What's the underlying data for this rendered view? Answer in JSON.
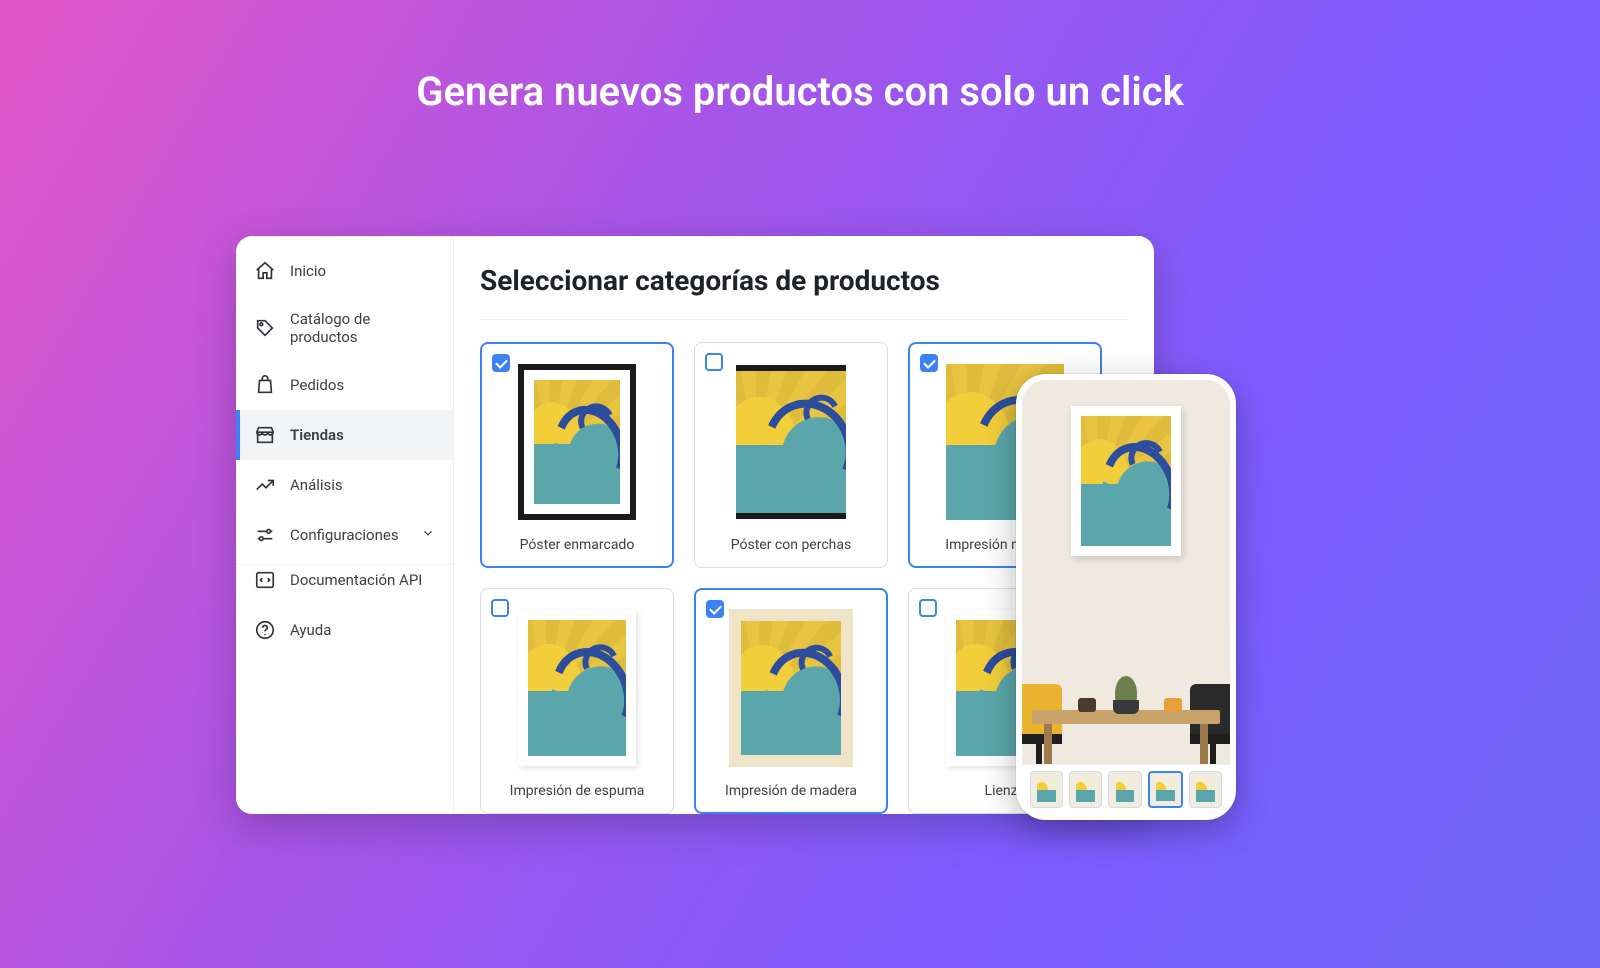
{
  "hero": {
    "title": "Genera nuevos productos con solo un click"
  },
  "sidebar": {
    "items": [
      {
        "label": "Inicio",
        "icon": "home-icon"
      },
      {
        "label": "Catálogo de productos",
        "icon": "tag-icon"
      },
      {
        "label": "Pedidos",
        "icon": "bag-icon"
      },
      {
        "label": "Tiendas",
        "icon": "store-icon",
        "active": true
      },
      {
        "label": "Análisis",
        "icon": "chart-icon"
      },
      {
        "label": "Configuraciones",
        "icon": "sliders-icon",
        "expandable": true
      },
      {
        "label": "Documentación API",
        "icon": "code-icon"
      },
      {
        "label": "Ayuda",
        "icon": "help-icon"
      }
    ]
  },
  "main": {
    "heading": "Seleccionar categorías de productos",
    "categories": [
      {
        "label": "Póster enmarcado",
        "selected": true,
        "style": "framed"
      },
      {
        "label": "Póster con perchas",
        "selected": false,
        "style": "hanger"
      },
      {
        "label": "Impresión metálica",
        "selected": true,
        "style": "plain"
      },
      {
        "label": "Impresión de espuma",
        "selected": false,
        "style": "mat"
      },
      {
        "label": "Impresión de madera",
        "selected": true,
        "style": "wood"
      },
      {
        "label": "Lienzo",
        "selected": false,
        "style": "mat"
      }
    ]
  },
  "phone": {
    "thumbnails": 5,
    "selected_index": 3
  },
  "colors": {
    "accent": "#3b82f6"
  }
}
